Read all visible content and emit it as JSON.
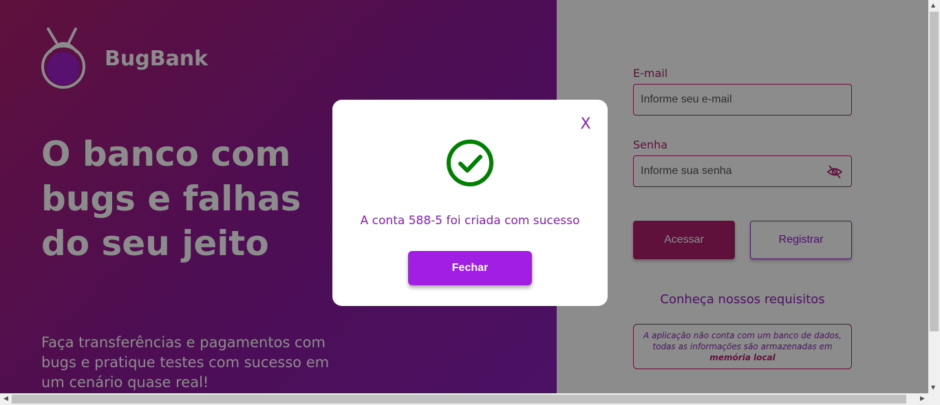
{
  "app": {
    "brand": "BugBank",
    "hero_title": "O banco com bugs e falhas do seu jeito",
    "hero_subtitle": "Faça transferências e pagamentos com bugs e pratique testes com sucesso em um cenário quase real!"
  },
  "login": {
    "email_label": "E-mail",
    "email_placeholder": "Informe seu e-mail",
    "password_label": "Senha",
    "password_placeholder": "Informe sua senha",
    "acessar_label": "Acessar",
    "registrar_label": "Registrar",
    "requirements_link": "Conheça nossos requisitos",
    "info_text": "A aplicação não conta com um banco de dados, todas as informações são armazenadas em",
    "info_bold": "memória local"
  },
  "modal": {
    "close_symbol": "X",
    "message": "A conta 588-5 foi criada com sucesso",
    "button_label": "Fechar"
  },
  "colors": {
    "brand_pink": "#ad1f6e",
    "brand_purple": "#8a1fb8",
    "button_purple": "#a11fe3",
    "success_green": "#008000"
  },
  "icons": {
    "logo": "bug-logo-icon",
    "password_toggle": "eye-slash-icon",
    "success": "check-circle-icon",
    "close": "close-icon"
  }
}
